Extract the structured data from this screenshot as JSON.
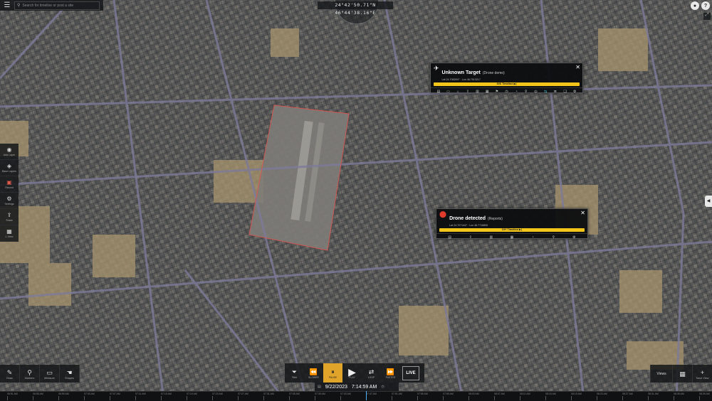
{
  "search": {
    "placeholder": "Search for timeline or post a site"
  },
  "coords": {
    "text": "24°42'50.71\"N 46°44'38.16\"E"
  },
  "topright": {
    "user_icon": "user-icon",
    "help_label": "?"
  },
  "left_tools": [
    {
      "label": "Add Layer",
      "icon": "eye-icon",
      "glyph": "◉"
    },
    {
      "label": "Base Layers",
      "icon": "layers-icon",
      "glyph": "◈"
    },
    {
      "label": "Record",
      "icon": "record-icon",
      "glyph": "▣"
    },
    {
      "label": "Settings",
      "icon": "gear-icon",
      "glyph": "⚙"
    },
    {
      "label": "Share",
      "icon": "share-icon",
      "glyph": "⇪"
    },
    {
      "label": "L-View",
      "icon": "grid-icon",
      "glyph": "▦"
    }
  ],
  "popups": {
    "target": {
      "title": "Unknown Target",
      "tag": "(Drone demo)",
      "sub": "Lat 24.7082697 · Lon 46.7513217",
      "bar": "GIS Timeline ▶|",
      "icons": [
        "▤",
        "▭",
        "⌂",
        "⇪",
        "▥",
        "▦",
        "⚑",
        "◷",
        "◔",
        "⚲",
        "◎",
        "⇆",
        "≣",
        "❏",
        "⚙"
      ]
    },
    "drone": {
      "title": "Drone detected",
      "tag": "(Reports)",
      "sub": "Lat 24.7071447 · Lon 46.7718890",
      "bar": "DIY Timeline ▶|",
      "icons": [
        "▤",
        "⇪",
        "▥",
        "▦",
        "◔",
        "⚲",
        "⚙"
      ]
    }
  },
  "bottom_left": [
    {
      "label": "Draw",
      "icon": "pen-icon",
      "glyph": "✎"
    },
    {
      "label": "Markers",
      "icon": "pin-icon",
      "glyph": "⚲"
    },
    {
      "label": "Measure",
      "icon": "ruler-icon",
      "glyph": "▭"
    },
    {
      "label": "Shapes",
      "icon": "hand-icon",
      "glyph": "☚"
    }
  ],
  "playbar": {
    "filter_label": "Filter",
    "back_label": "SLOWER",
    "pause_label": "PAUSE",
    "play_label": "PLAY",
    "loop_label": "LOOP",
    "fwd_label": "FASTER",
    "live_label": "LIVE"
  },
  "datetime": {
    "date": "9/22/2023",
    "time": "7:14:59 AM"
  },
  "bottom_right": {
    "views_label": "Views",
    "save_label": "Save View"
  },
  "timeline_ticks": [
    "06:51 AM",
    "06:55 AM",
    "06:59 AM",
    "07:03 AM",
    "07:07 AM",
    "07:11 AM",
    "07:15 AM",
    "07:19 AM",
    "07:23 AM",
    "07:27 AM",
    "07:31 AM",
    "07:35 AM",
    "07:39 AM",
    "07:43 AM",
    "07:47 AM",
    "07:51 AM",
    "07:55 AM",
    "07:59 AM",
    "08:03 AM",
    "08:07 AM",
    "08:11 AM",
    "08:15 AM",
    "08:19 AM",
    "08:23 AM",
    "08:27 AM",
    "08:31 AM",
    "08:35 AM",
    "08:39 AM"
  ],
  "colors": {
    "accent": "#f3c41a",
    "pause": "#e0a42a",
    "selection": "#d9534f",
    "drone_pin": "#e23b2e"
  }
}
